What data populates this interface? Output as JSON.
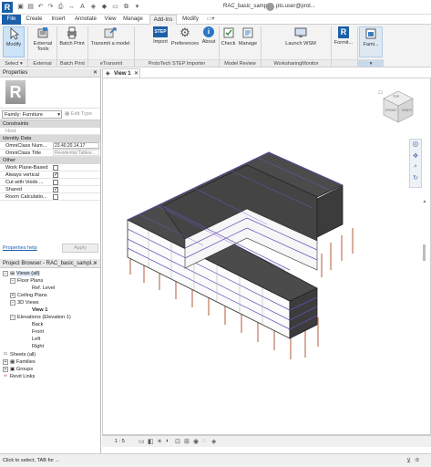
{
  "app": {
    "logo": "R",
    "document_title": "RAC_basic_samp...",
    "user": "pts.user@prot..."
  },
  "tabs": [
    "File",
    "Create",
    "Insert",
    "Annotate",
    "View",
    "Manage",
    "Add-Ins",
    "Modify"
  ],
  "active_tab": "Add-Ins",
  "ribbon": {
    "buttons": {
      "modify": "Modify",
      "external_tools": "External Tools",
      "batch_print": "Batch Print",
      "transmit": "Transmit a model",
      "import": "Import",
      "preferences": "Preferences",
      "about": "About",
      "check": "Check",
      "manage": "Manage",
      "launch_wsm": "Launch WSM",
      "formit": "Formit...",
      "family": "Fami..."
    },
    "panels": {
      "select": "Select ▾",
      "external": "External",
      "batch_print": "Batch Print",
      "etransmit": "eTransmit",
      "prototech": "ProtoTech STEP Importer",
      "model_review": "Model Review",
      "worksharing": "WorksharingMonitor",
      "formit": "",
      "family": "▾"
    },
    "step_badge": "STEP"
  },
  "properties": {
    "title": "Properties",
    "type_selector": "Family: Furniture",
    "edit_type": "Edit Type",
    "sections": {
      "constraints": "Constraints",
      "identity": "Identity Data",
      "other": "Other"
    },
    "host_label": "Host",
    "omniclass_number_label": "OmniClass Num...",
    "omniclass_number_value": "23.40.20.14.17",
    "omniclass_title_label": "OmniClass Title",
    "omniclass_title_value": "Residential Tables...",
    "rows": [
      {
        "label": "Work Plane-Based",
        "checked": false
      },
      {
        "label": "Always vertical",
        "checked": true
      },
      {
        "label": "Cut with Voids ...",
        "checked": false
      },
      {
        "label": "Shared",
        "checked": true
      },
      {
        "label": "Room Calculatio...",
        "checked": false
      }
    ],
    "help_link": "Properties help",
    "apply": "Apply"
  },
  "project_browser": {
    "title": "Project Browser - RAC_basic_sampl...",
    "items": {
      "views": "Views (all)",
      "floor_plans": "Floor Plans",
      "ref_level": "Ref. Level",
      "ceiling_plans": "Ceiling Plans",
      "views_3d": "3D Views",
      "view1": "View 1",
      "elevations": "Elevations (Elevation 1)",
      "back": "Back",
      "front": "Front",
      "left": "Left",
      "right": "Right",
      "sheets": "Sheets (all)",
      "families": "Families",
      "groups": "Groups",
      "revit_links": "Revit Links"
    }
  },
  "view": {
    "tab_title": "View 1",
    "scale": "1 : 5",
    "cube_labels": [
      "TOP",
      "FRONT",
      "RIGHT"
    ]
  },
  "status": {
    "text": "Click to select, TAB for ...",
    "filter_count": ":0"
  }
}
